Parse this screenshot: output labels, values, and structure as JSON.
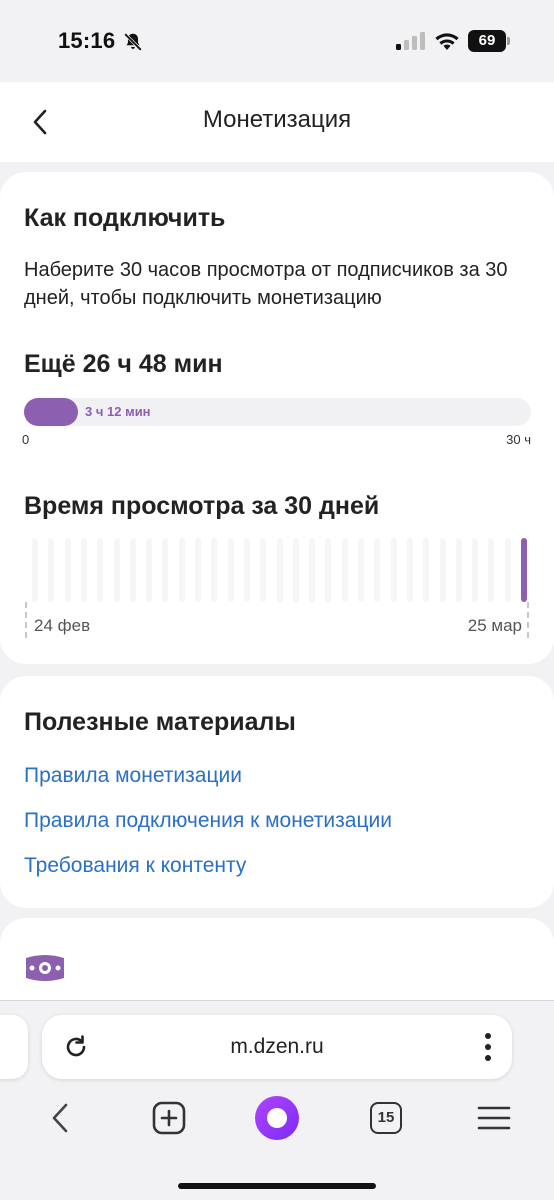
{
  "status_bar": {
    "time": "15:16",
    "battery": "69",
    "icons": [
      "bell-slash-icon",
      "signal-icon",
      "wifi-icon",
      "battery-icon"
    ]
  },
  "header": {
    "title": "Монетизация",
    "back_icon": "chevron-left-icon"
  },
  "connect_card": {
    "title": "Как подключить",
    "description": "Наберите 30 часов просмотра от подписчиков за 30 дней, чтобы подключить монетизацию",
    "remaining": "Ещё 26 ч 48 мин",
    "progress": {
      "current_label": "3 ч 12 мин",
      "fraction": 0.107,
      "min_label": "0",
      "max_label": "30 ч"
    },
    "chart_title": "Время просмотра за 30 дней",
    "chart_data": {
      "type": "bar",
      "title": "Время просмотра за 30 дней",
      "x_start_label": "24 фев",
      "x_end_label": "25 мар",
      "values": [
        0,
        0,
        0,
        0,
        0,
        0,
        0,
        0,
        0,
        0,
        0,
        0,
        0,
        0,
        0,
        0,
        0,
        0,
        0,
        0,
        0,
        0,
        0,
        0,
        0,
        0,
        0,
        0,
        0,
        0,
        1
      ],
      "ylim": [
        0,
        1
      ],
      "colors": {
        "bar": "#8c5fb0",
        "empty": "#f6f6f7"
      }
    }
  },
  "materials_card": {
    "title": "Полезные материалы",
    "links": [
      "Правила монетизации",
      "Правила подключения к монетизации",
      "Требования к контенту"
    ]
  },
  "partial_card": {
    "icon": "money-icon"
  },
  "browser": {
    "url": "m.dzen.ru",
    "tabs_count": "15",
    "nav_icons": [
      "back-icon",
      "new-tab-icon",
      "alice-icon",
      "tabs-icon",
      "menu-icon"
    ]
  },
  "colors": {
    "accent": "#8c5fb0",
    "link": "#2a6fc9",
    "background": "#f2f2f4"
  }
}
